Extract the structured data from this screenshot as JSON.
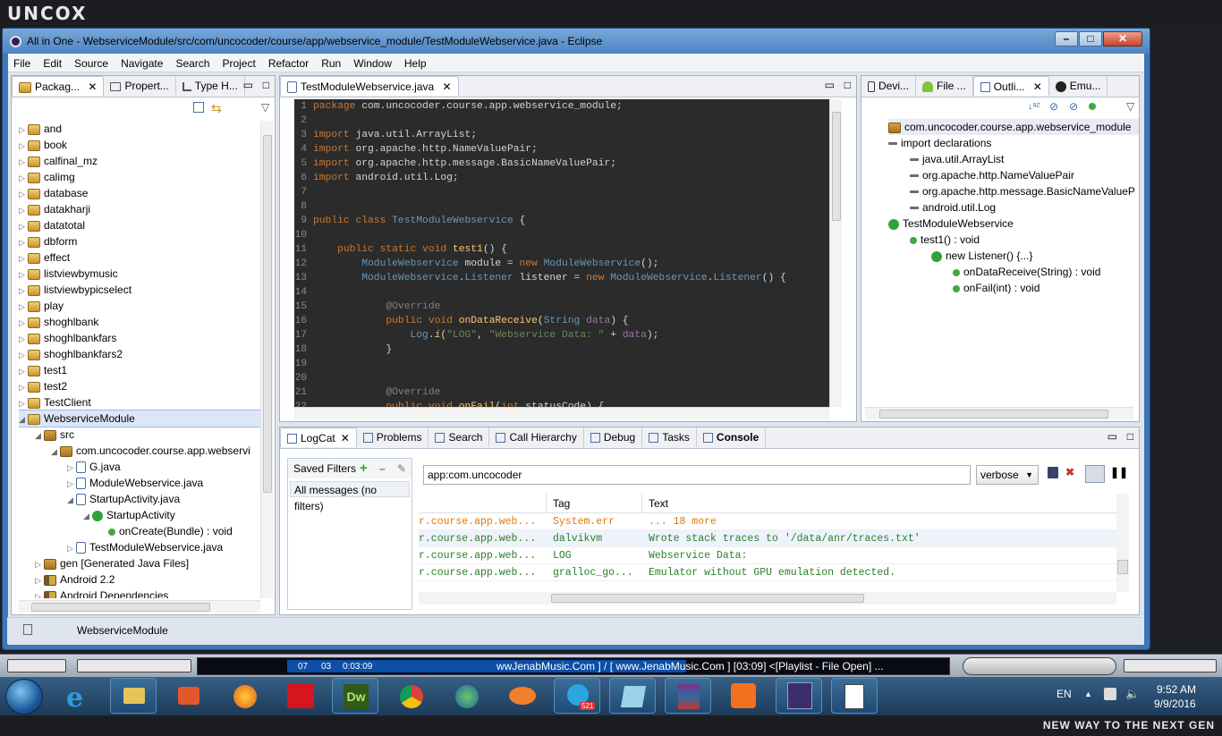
{
  "top_logo": "UNCOX",
  "window": {
    "title": "All in One - WebserviceModule/src/com/uncocoder/course/app/webservice_module/TestModuleWebservice.java - Eclipse"
  },
  "menu": [
    "File",
    "Edit",
    "Source",
    "Navigate",
    "Search",
    "Project",
    "Refactor",
    "Run",
    "Window",
    "Help"
  ],
  "left_tabs": [
    "Packag...",
    "Propert...",
    "Type H..."
  ],
  "tree": [
    {
      "label": "and",
      "icon": "prj",
      "indent": 0,
      "arrow": "▷"
    },
    {
      "label": "book",
      "icon": "prj",
      "indent": 0,
      "arrow": "▷"
    },
    {
      "label": "calfinal_mz",
      "icon": "prj",
      "indent": 0,
      "arrow": "▷"
    },
    {
      "label": "calimg",
      "icon": "prj",
      "indent": 0,
      "arrow": "▷"
    },
    {
      "label": "database",
      "icon": "prj",
      "indent": 0,
      "arrow": "▷"
    },
    {
      "label": "datakharji",
      "icon": "prj",
      "indent": 0,
      "arrow": "▷"
    },
    {
      "label": "datatotal",
      "icon": "prj",
      "indent": 0,
      "arrow": "▷"
    },
    {
      "label": "dbform",
      "icon": "prj",
      "indent": 0,
      "arrow": "▷"
    },
    {
      "label": "effect",
      "icon": "prj",
      "indent": 0,
      "arrow": "▷"
    },
    {
      "label": "listviewbymusic",
      "icon": "prj",
      "indent": 0,
      "arrow": "▷"
    },
    {
      "label": "listviewbypicselect",
      "icon": "prj",
      "indent": 0,
      "arrow": "▷"
    },
    {
      "label": "play",
      "icon": "prj",
      "indent": 0,
      "arrow": "▷"
    },
    {
      "label": "shoghlbank",
      "icon": "prj",
      "indent": 0,
      "arrow": "▷"
    },
    {
      "label": "shoghlbankfars",
      "icon": "prj",
      "indent": 0,
      "arrow": "▷"
    },
    {
      "label": "shoghlbankfars2",
      "icon": "prj",
      "indent": 0,
      "arrow": "▷"
    },
    {
      "label": "test1",
      "icon": "prj",
      "indent": 0,
      "arrow": "▷"
    },
    {
      "label": "test2",
      "icon": "prj",
      "indent": 0,
      "arrow": "▷"
    },
    {
      "label": "TestClient",
      "icon": "prj",
      "indent": 0,
      "arrow": "▷"
    },
    {
      "label": "WebserviceModule",
      "icon": "prj",
      "indent": 0,
      "arrow": "◢",
      "selected": true
    },
    {
      "label": "src",
      "icon": "pkg",
      "indent": 1,
      "arrow": "◢"
    },
    {
      "label": "com.uncocoder.course.app.webservi",
      "icon": "pkg",
      "indent": 2,
      "arrow": "◢"
    },
    {
      "label": "G.java",
      "icon": "java",
      "indent": 3,
      "arrow": "▷"
    },
    {
      "label": "ModuleWebservice.java",
      "icon": "java",
      "indent": 3,
      "arrow": "▷"
    },
    {
      "label": "StartupActivity.java",
      "icon": "java",
      "indent": 3,
      "arrow": "◢"
    },
    {
      "label": "StartupActivity",
      "icon": "cls",
      "indent": 4,
      "arrow": "◢"
    },
    {
      "label": "onCreate(Bundle) : void",
      "icon": "meth",
      "indent": 5,
      "arrow": ""
    },
    {
      "label": "TestModuleWebservice.java",
      "icon": "java",
      "indent": 3,
      "arrow": "▷"
    },
    {
      "label": "gen [Generated Java Files]",
      "icon": "pkg",
      "indent": 1,
      "arrow": "▷"
    },
    {
      "label": "Android 2.2",
      "icon": "ref",
      "indent": 1,
      "arrow": "▷"
    },
    {
      "label": "Android Dependencies",
      "icon": "ref",
      "indent": 1,
      "arrow": "▷"
    }
  ],
  "editor": {
    "tab": "TestModuleWebservice.java"
  },
  "right_tabs": [
    "Devi...",
    "File ...",
    "Outli...",
    "Emu..."
  ],
  "outline": [
    {
      "label": "com.uncocoder.course.app.webservice_module",
      "indent": 0,
      "icon": "pkg"
    },
    {
      "label": "import declarations",
      "indent": 0,
      "icon": "imp"
    },
    {
      "label": "java.util.ArrayList",
      "indent": 1,
      "icon": "imp"
    },
    {
      "label": "org.apache.http.NameValuePair",
      "indent": 1,
      "icon": "imp"
    },
    {
      "label": "org.apache.http.message.BasicNameValueP",
      "indent": 1,
      "icon": "imp"
    },
    {
      "label": "android.util.Log",
      "indent": 1,
      "icon": "imp"
    },
    {
      "label": "TestModuleWebservice",
      "indent": 0,
      "icon": "cls"
    },
    {
      "label": "test1() : void",
      "indent": 1,
      "icon": "meth"
    },
    {
      "label": "new Listener() {...}",
      "indent": 2,
      "icon": "cls"
    },
    {
      "label": "onDataReceive(String) : void",
      "indent": 3,
      "icon": "meth"
    },
    {
      "label": "onFail(int) : void",
      "indent": 3,
      "icon": "meth"
    }
  ],
  "bottom_tabs": [
    "LogCat",
    "Problems",
    "Search",
    "Call Hierarchy",
    "Debug",
    "Tasks",
    "Console"
  ],
  "logcat": {
    "saved_filters_label": "Saved Filters",
    "all_messages": "All messages (no filters)",
    "search_value": "app:com.uncocoder",
    "level": "verbose",
    "col_tag": "Tag",
    "col_text": "Text",
    "rows": [
      {
        "app": "r.course.app.web...",
        "tag": "System.err",
        "text": "... 18 more",
        "color": "#e07b00"
      },
      {
        "app": "r.course.app.web...",
        "tag": "dalvikvm",
        "text": "Wrote stack traces to '/data/anr/traces.txt'",
        "color": "#2a7e2a"
      },
      {
        "app": "r.course.app.web...",
        "tag": "LOG",
        "text": "Webservice Data:",
        "color": "#2a7e2a"
      },
      {
        "app": "r.course.app.web...",
        "tag": "gralloc_go...",
        "text": "Emulator without GPU emulation detected.",
        "color": "#2a7e2a"
      }
    ]
  },
  "status": {
    "selected": "WebserviceModule"
  },
  "player": {
    "time1": "07",
    "time2": "03",
    "time3": "0:03:09",
    "track": "wwJenabMusic.Com ] / [ www.JenabMusic.Com ]  [03:09]    <[Playlist - File Open] ..."
  },
  "taskbar": {
    "lang": "EN",
    "time": "9:52 AM",
    "date": "9/9/2016",
    "telegram_badge": "521"
  },
  "bottom_slogan": "NEW WAY TO THE NEXT GEN"
}
